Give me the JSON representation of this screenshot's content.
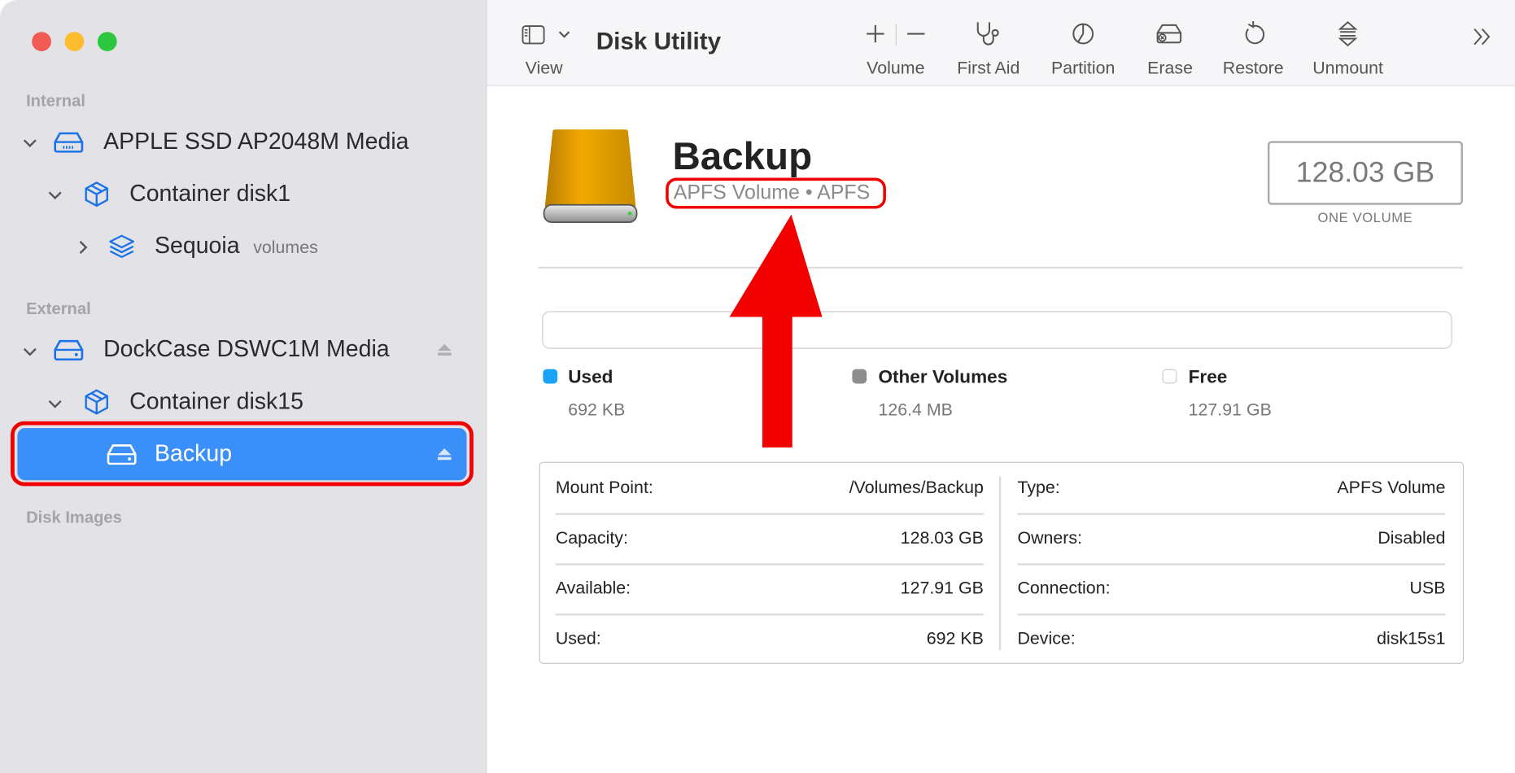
{
  "window": {
    "traffic_lights": {
      "close": "#f25a53",
      "minimize": "#fcbc2d",
      "zoom": "#2cc73f"
    }
  },
  "sidebar": {
    "sections": [
      {
        "label": "Internal"
      },
      {
        "label": "External"
      },
      {
        "label": "Disk Images"
      }
    ],
    "items": [
      {
        "label": "APPLE SSD AP2048M Media",
        "icon": "internal-drive-icon",
        "expanded": true
      },
      {
        "label": "Container disk1",
        "icon": "container-cube-icon",
        "expanded": true
      },
      {
        "label": "Sequoia",
        "sublabel": "volumes",
        "icon": "volume-stack-icon",
        "expanded": false
      },
      {
        "label": "DockCase DSWC1M Media",
        "icon": "external-drive-icon",
        "expanded": true,
        "ejectable": true
      },
      {
        "label": "Container disk15",
        "icon": "container-cube-icon",
        "expanded": true
      },
      {
        "label": "Backup",
        "icon": "volume-drive-icon",
        "selected": true,
        "ejectable": true
      }
    ],
    "selection_color": "#3b8ff8"
  },
  "toolbar": {
    "view_label": "View",
    "title": "Disk Utility",
    "buttons": [
      {
        "label": "Volume",
        "icon": "plus-minus-icon"
      },
      {
        "label": "First Aid",
        "icon": "stethoscope-icon"
      },
      {
        "label": "Partition",
        "icon": "pie-chart-icon"
      },
      {
        "label": "Erase",
        "icon": "erase-drive-icon"
      },
      {
        "label": "Restore",
        "icon": "restore-arrow-icon"
      },
      {
        "label": "Unmount",
        "icon": "unmount-icon"
      }
    ],
    "overflow_icon": "chevron-double-right-icon"
  },
  "volume": {
    "name": "Backup",
    "subtitle": "APFS Volume • APFS",
    "capacity": "128.03 GB",
    "capacity_caption": "ONE VOLUME"
  },
  "usage": {
    "legend": [
      {
        "label": "Used",
        "value": "692 KB",
        "color": "#1aa3f7"
      },
      {
        "label": "Other Volumes",
        "value": "126.4 MB",
        "color": "#8e8e8e"
      },
      {
        "label": "Free",
        "value": "127.91 GB",
        "color": "#ffffff"
      }
    ]
  },
  "info": {
    "left": [
      {
        "label": "Mount Point:",
        "value": "/Volumes/Backup"
      },
      {
        "label": "Capacity:",
        "value": "128.03 GB"
      },
      {
        "label": "Available:",
        "value": "127.91 GB"
      },
      {
        "label": "Used:",
        "value": "692 KB"
      }
    ],
    "right": [
      {
        "label": "Type:",
        "value": "APFS Volume"
      },
      {
        "label": "Owners:",
        "value": "Disabled"
      },
      {
        "label": "Connection:",
        "value": "USB"
      },
      {
        "label": "Device:",
        "value": "disk15s1"
      }
    ]
  },
  "annotation": {
    "color": "#f20000"
  }
}
